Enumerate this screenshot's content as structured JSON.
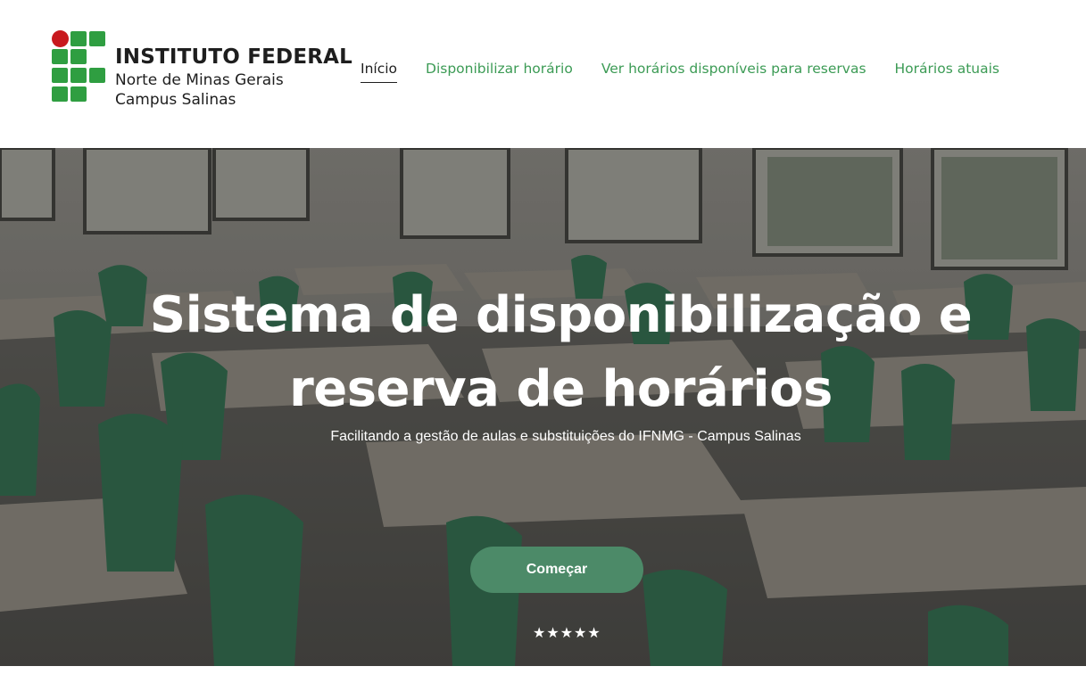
{
  "logo": {
    "title": "INSTITUTO FEDERAL",
    "line2": "Norte de Minas Gerais",
    "line3": "Campus Salinas",
    "colors": {
      "green": "#2f9e41",
      "red": "#c8191e"
    }
  },
  "nav": {
    "items": [
      {
        "label": "Início",
        "active": true
      },
      {
        "label": "Disponibilizar horário",
        "active": false
      },
      {
        "label": "Ver horários disponíveis para reservas",
        "active": false
      },
      {
        "label": "Horários atuais",
        "active": false
      }
    ]
  },
  "hero": {
    "title": "Sistema de disponibilização e reserva de horários",
    "subtitle": "Facilitando a gestão de aulas e substituições do IFNMG - Campus Salinas",
    "cta_label": "Começar",
    "rating_stars": "★★★★★",
    "accent_color": "#4c8a68"
  }
}
